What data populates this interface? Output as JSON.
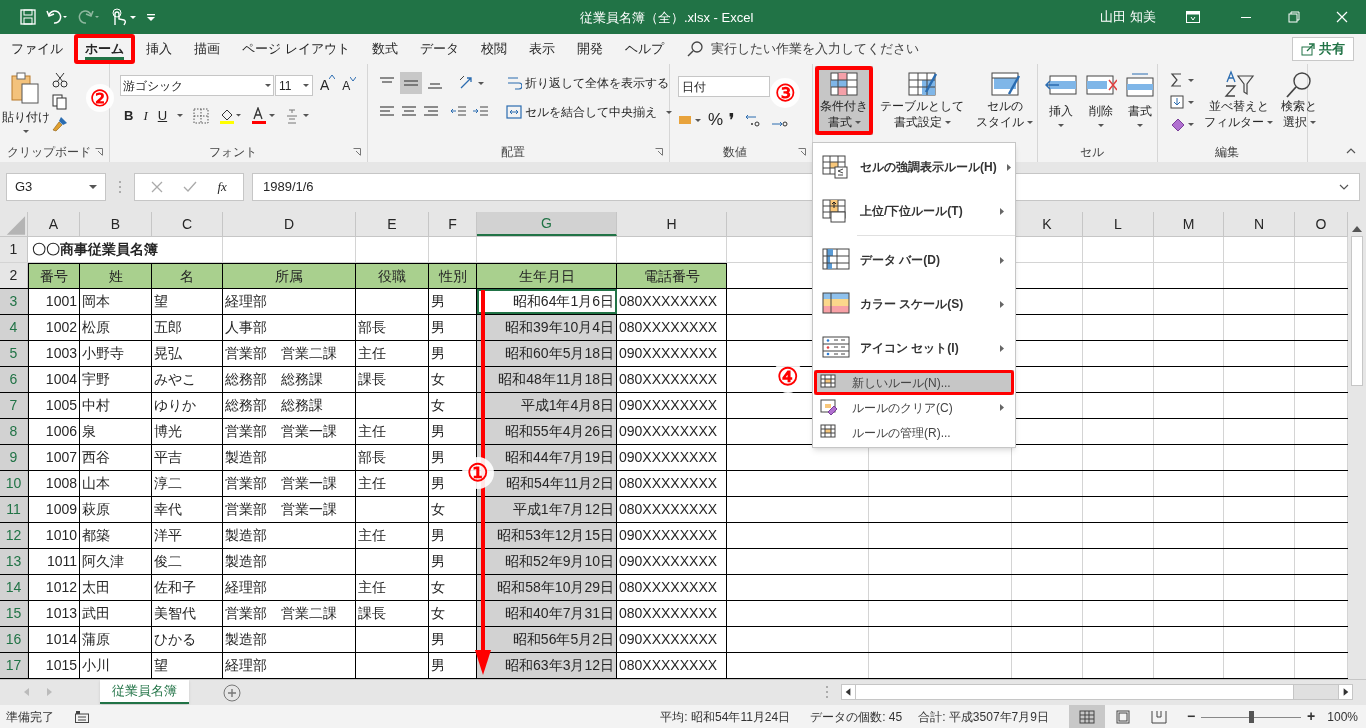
{
  "window": {
    "title": "従業員名簿（全）.xlsx  -  Excel",
    "user": "山田 知美"
  },
  "tabs": [
    {
      "label": "ファイル",
      "selected": false
    },
    {
      "label": "ホーム",
      "selected": true
    },
    {
      "label": "挿入",
      "selected": false
    },
    {
      "label": "描画",
      "selected": false
    },
    {
      "label": "ページ レイアウト",
      "selected": false
    },
    {
      "label": "数式",
      "selected": false
    },
    {
      "label": "データ",
      "selected": false
    },
    {
      "label": "校閲",
      "selected": false
    },
    {
      "label": "表示",
      "selected": false
    },
    {
      "label": "開発",
      "selected": false
    },
    {
      "label": "ヘルプ",
      "selected": false
    }
  ],
  "tell_me": {
    "placeholder": "実行したい作業を入力してください"
  },
  "share_button": "共有",
  "ribbon": {
    "clipboard": {
      "label": "クリップボード",
      "paste": "貼り付け"
    },
    "font": {
      "label": "フォント",
      "font_name": "游ゴシック",
      "font_size": "11",
      "bold": "B",
      "italic": "I",
      "underline": "U",
      "grow": "A",
      "shrink": "A"
    },
    "alignment": {
      "label": "配置",
      "wrap": "折り返して全体を表示する",
      "merge": "セルを結合して中央揃え"
    },
    "number": {
      "label": "数値",
      "format": "日付",
      "percent": "%",
      "comma": "❜"
    },
    "styles": {
      "buttons": [
        {
          "lines": [
            "条件付き",
            "書式"
          ],
          "pressed": true
        },
        {
          "lines": [
            "テーブルとして",
            "書式設定"
          ],
          "pressed": false
        },
        {
          "lines": [
            "セルの",
            "スタイル"
          ],
          "pressed": false
        }
      ]
    },
    "cells": {
      "label": "セル",
      "buttons": [
        "挿入",
        "削除",
        "書式"
      ]
    },
    "editing": {
      "label": "編集",
      "buttons": [
        {
          "lines": [
            "並べ替えと",
            "フィルター"
          ]
        },
        {
          "lines": [
            "検索と",
            "選択"
          ]
        }
      ]
    }
  },
  "formula_bar": {
    "name_box": "G3",
    "function_button": "fx",
    "formula": "1989/1/6"
  },
  "columns": [
    {
      "label": "A",
      "selected": false
    },
    {
      "label": "B",
      "selected": false
    },
    {
      "label": "C",
      "selected": false
    },
    {
      "label": "D",
      "selected": false
    },
    {
      "label": "E",
      "selected": false
    },
    {
      "label": "F",
      "selected": false
    },
    {
      "label": "G",
      "selected": true
    },
    {
      "label": "H",
      "selected": false
    }
  ],
  "far_columns": [
    "K",
    "L",
    "M",
    "N",
    "O"
  ],
  "rows": [
    {
      "number": "1",
      "kind": "title",
      "selected": false,
      "cells": [
        "〇〇商事従業員名簿"
      ]
    },
    {
      "number": "2",
      "kind": "header",
      "selected": false,
      "cells": [
        "番号",
        "姓",
        "名",
        "所属",
        "役職",
        "性別",
        "生年月日",
        "電話番号"
      ]
    },
    {
      "number": "3",
      "kind": "data",
      "selected": true,
      "active": true,
      "cells": [
        "1001",
        "岡本",
        "望",
        "経理部",
        "",
        "男",
        "昭和64年1月6日",
        "080XXXXXXXX"
      ]
    },
    {
      "number": "4",
      "kind": "data",
      "selected": true,
      "active": false,
      "cells": [
        "1002",
        "松原",
        "五郎",
        "人事部",
        "部長",
        "男",
        "昭和39年10月4日",
        "080XXXXXXXX"
      ]
    },
    {
      "number": "5",
      "kind": "data",
      "selected": true,
      "active": false,
      "cells": [
        "1003",
        "小野寺",
        "晃弘",
        "営業部　営業二課",
        "主任",
        "男",
        "昭和60年5月18日",
        "090XXXXXXXX"
      ]
    },
    {
      "number": "6",
      "kind": "data",
      "selected": true,
      "active": false,
      "cells": [
        "1004",
        "宇野",
        "みやこ",
        "総務部　総務課",
        "課長",
        "女",
        "昭和48年11月18日",
        "080XXXXXXXX"
      ]
    },
    {
      "number": "7",
      "kind": "data",
      "selected": true,
      "active": false,
      "cells": [
        "1005",
        "中村",
        "ゆりか",
        "総務部　総務課",
        "",
        "女",
        "平成1年4月8日",
        "090XXXXXXXX"
      ]
    },
    {
      "number": "8",
      "kind": "data",
      "selected": true,
      "active": false,
      "cells": [
        "1006",
        "泉",
        "博光",
        "営業部　営業一課",
        "主任",
        "男",
        "昭和55年4月26日",
        "090XXXXXXXX"
      ]
    },
    {
      "number": "9",
      "kind": "data",
      "selected": true,
      "active": false,
      "cells": [
        "1007",
        "西谷",
        "平吉",
        "製造部",
        "部長",
        "男",
        "昭和44年7月19日",
        "090XXXXXXXX"
      ]
    },
    {
      "number": "10",
      "kind": "data",
      "selected": true,
      "active": false,
      "cells": [
        "1008",
        "山本",
        "淳二",
        "営業部　営業一課",
        "主任",
        "男",
        "昭和54年11月2日",
        "080XXXXXXXX"
      ]
    },
    {
      "number": "11",
      "kind": "data",
      "selected": true,
      "active": false,
      "cells": [
        "1009",
        "萩原",
        "幸代",
        "営業部　営業一課",
        "",
        "女",
        "平成1年7月12日",
        "080XXXXXXXX"
      ]
    },
    {
      "number": "12",
      "kind": "data",
      "selected": true,
      "active": false,
      "cells": [
        "1010",
        "都築",
        "洋平",
        "製造部",
        "主任",
        "男",
        "昭和53年12月15日",
        "090XXXXXXXX"
      ]
    },
    {
      "number": "13",
      "kind": "data",
      "selected": true,
      "active": false,
      "cells": [
        "1011",
        "阿久津",
        "俊二",
        "製造部",
        "",
        "男",
        "昭和52年9月10日",
        "090XXXXXXXX"
      ]
    },
    {
      "number": "14",
      "kind": "data",
      "selected": true,
      "active": false,
      "cells": [
        "1012",
        "太田",
        "佐和子",
        "経理部",
        "主任",
        "女",
        "昭和58年10月29日",
        "080XXXXXXXX"
      ]
    },
    {
      "number": "15",
      "kind": "data",
      "selected": true,
      "active": false,
      "cells": [
        "1013",
        "武田",
        "美智代",
        "営業部　営業二課",
        "課長",
        "女",
        "昭和40年7月31日",
        "080XXXXXXXX"
      ]
    },
    {
      "number": "16",
      "kind": "data",
      "selected": true,
      "active": false,
      "cells": [
        "1014",
        "蒲原",
        "ひかる",
        "製造部",
        "",
        "男",
        "昭和56年5月2日",
        "090XXXXXXXX"
      ]
    },
    {
      "number": "17",
      "kind": "data",
      "selected": true,
      "active": false,
      "cells": [
        "1015",
        "小川",
        "望",
        "経理部",
        "",
        "男",
        "昭和63年3月12日",
        "080XXXXXXXX"
      ]
    }
  ],
  "menu": [
    {
      "label": "セルの強調表示ルール(H)",
      "kind": "large",
      "highlighted": false,
      "submenu": true
    },
    {
      "label": "上位/下位ルール(T)",
      "kind": "large",
      "highlighted": false,
      "submenu": true
    },
    {
      "label": "データ バー(D)",
      "kind": "large",
      "highlighted": false,
      "submenu": true
    },
    {
      "label": "カラー スケール(S)",
      "kind": "large",
      "highlighted": false,
      "submenu": true
    },
    {
      "label": "アイコン セット(I)",
      "kind": "large",
      "highlighted": false,
      "submenu": true
    },
    {
      "label": "新しいルール(N)...",
      "kind": "small",
      "highlighted": true,
      "submenu": false
    },
    {
      "label": "ルールのクリア(C)",
      "kind": "small",
      "highlighted": false,
      "submenu": true
    },
    {
      "label": "ルールの管理(R)...",
      "kind": "small",
      "highlighted": false,
      "submenu": false
    }
  ],
  "sheet_tabs": [
    {
      "label": "従業員名簿",
      "selected": true
    }
  ],
  "status_bar": {
    "ready": "準備完了",
    "average": "平均: 昭和54年11月24日",
    "count": "データの個数: 45",
    "sum": "合計: 平成3507年7月9日",
    "views": [
      {
        "selected": true
      },
      {
        "selected": false
      },
      {
        "selected": false
      }
    ],
    "zoom_out": "−",
    "zoom_in": "+",
    "zoom_slider": {
      "level": 0.5
    },
    "zoom": "100%"
  },
  "annotations": [
    "①",
    "②",
    "③",
    "④"
  ]
}
